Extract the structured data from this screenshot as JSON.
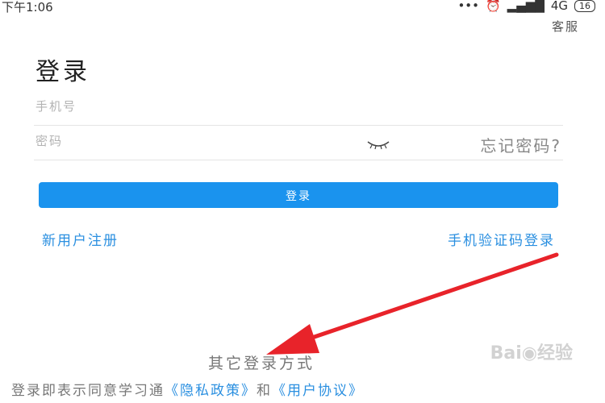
{
  "status_bar": {
    "time": "下午1:06",
    "network": "4G",
    "battery": "16"
  },
  "header": {
    "service_label": "客服"
  },
  "main": {
    "title": "登录",
    "phone_placeholder": "手机号",
    "password_placeholder": "密码",
    "forgot_password": "忘记密码?",
    "login_button": "登录",
    "register_link": "新用户注册",
    "sms_login_link": "手机验证码登录",
    "other_login": "其它登录方式"
  },
  "footer": {
    "agree_prefix": "登录即表示同意学习通",
    "privacy_link": "《隐私政策》",
    "and": "和",
    "user_agreement_link": "《用户协议》"
  },
  "icons": {
    "eye": "eye-closed-icon",
    "signal": "signal-icon",
    "battery": "battery-icon"
  },
  "colors": {
    "accent": "#1a93ee",
    "link": "#2a8fe0",
    "annotation_arrow": "#e8232a"
  }
}
